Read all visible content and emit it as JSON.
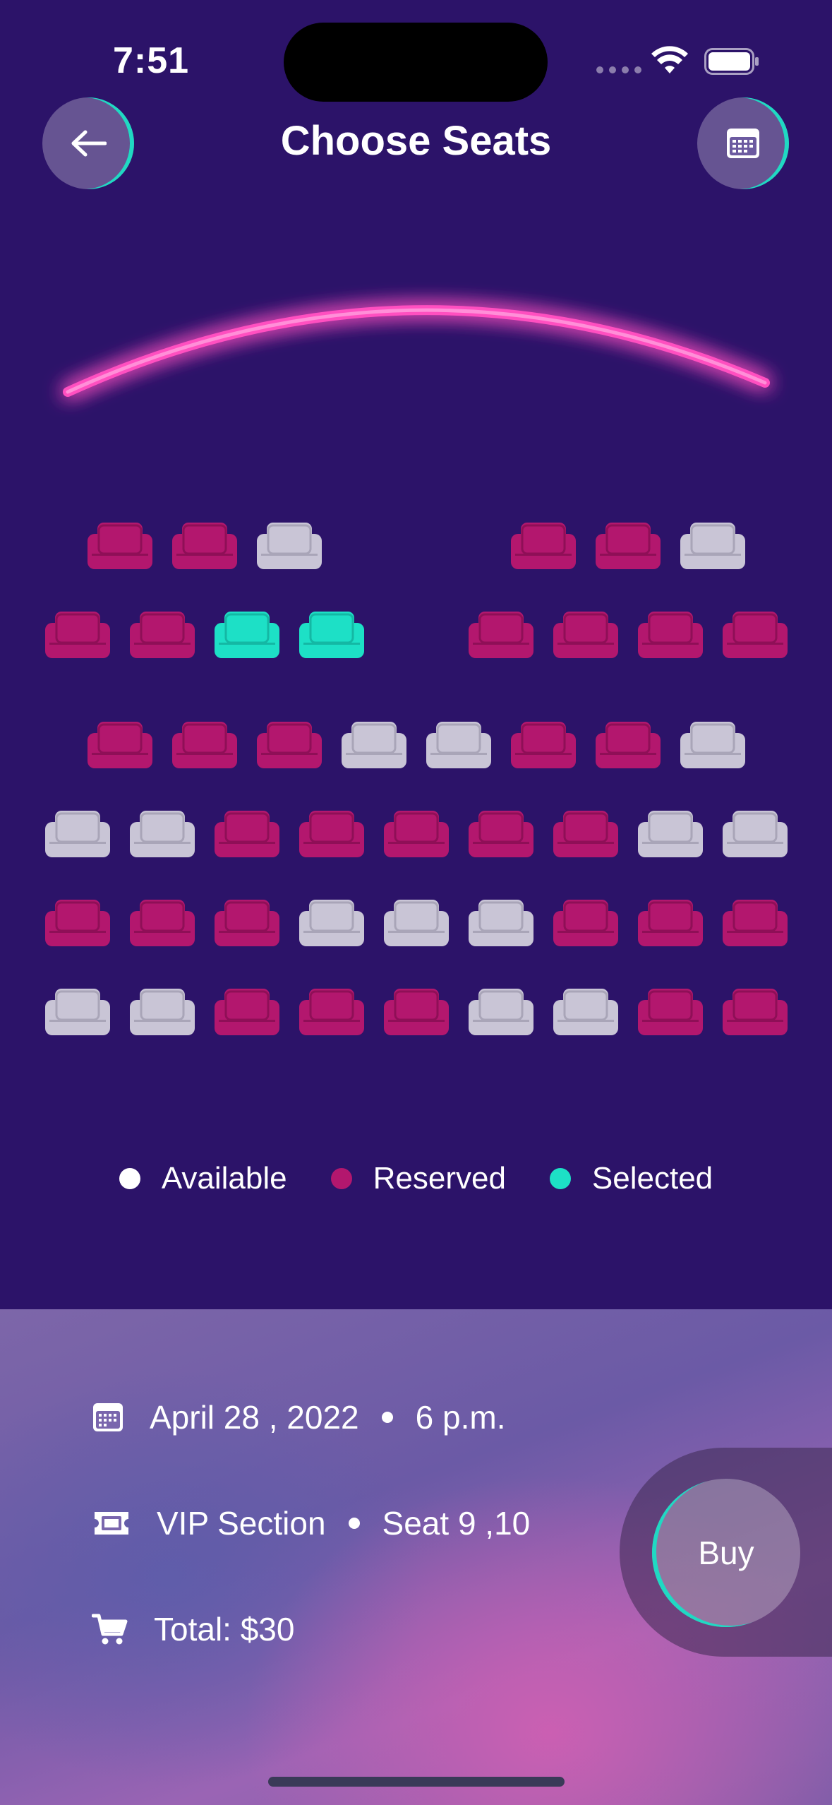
{
  "status_bar": {
    "time": "7:51"
  },
  "header": {
    "title": "Choose Seats",
    "back_icon": "arrow-left-icon",
    "calendar_icon": "calendar-icon"
  },
  "colors": {
    "background": "#2c1369",
    "available": "#c9c5d6",
    "reserved": "#b3176e",
    "selected": "#1de0c6",
    "screen_glow": "#ff4fc0"
  },
  "seat_rows": [
    [
      "",
      "reserved",
      "reserved",
      "available",
      "",
      "",
      "reserved",
      "reserved",
      "available"
    ],
    [
      "reserved",
      "reserved",
      "selected",
      "selected",
      "",
      "reserved",
      "reserved",
      "reserved",
      "reserved"
    ],
    [
      "",
      "reserved",
      "reserved",
      "reserved",
      "available",
      "available",
      "reserved",
      "reserved",
      "available"
    ],
    [
      "available",
      "available",
      "reserved",
      "reserved",
      "reserved",
      "reserved",
      "reserved",
      "available",
      "available"
    ],
    [
      "reserved",
      "reserved",
      "reserved",
      "available",
      "available",
      "available",
      "reserved",
      "reserved",
      "reserved"
    ],
    [
      "available",
      "available",
      "reserved",
      "reserved",
      "reserved",
      "available",
      "available",
      "reserved",
      "reserved"
    ]
  ],
  "legend": {
    "available": "Available",
    "reserved": "Reserved",
    "selected": "Selected"
  },
  "booking": {
    "date": "April 28 , 2022",
    "time": "6 p.m.",
    "section": "VIP Section",
    "seats": "Seat 9 ,10",
    "total": "Total: $30"
  },
  "buy_label": "Buy"
}
